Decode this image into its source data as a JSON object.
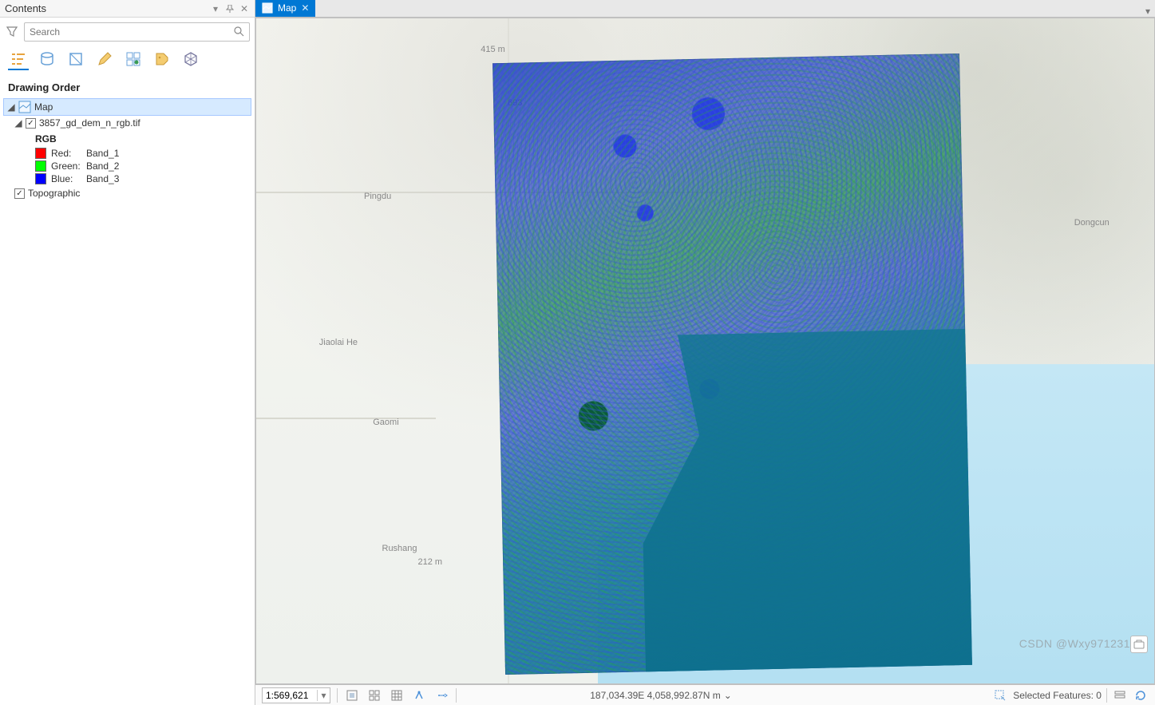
{
  "contents": {
    "title": "Contents",
    "search_placeholder": "Search",
    "section": "Drawing Order",
    "map_node": "Map",
    "layer_node": "3857_gd_dem_n_rgb.tif",
    "rgb_title": "RGB",
    "bands": [
      {
        "color": "#ff0000",
        "label": "Red:",
        "value": "Band_1"
      },
      {
        "color": "#00ff00",
        "label": "Green:",
        "value": "Band_2"
      },
      {
        "color": "#0000ff",
        "label": "Blue:",
        "value": "Band_3"
      }
    ],
    "basemap_node": "Topographic"
  },
  "map_tab": {
    "label": "Map"
  },
  "basemap_labels": {
    "pingdu": "Pingdu",
    "gaomi": "Gaomi",
    "jiaolai": "Jiaolai He",
    "rushang": "Rushang",
    "dongcun": "Dongcun",
    "elev1": "415 m",
    "elev2": "693",
    "elev3": "212 m"
  },
  "statusbar": {
    "scale": "1:569,621",
    "coords": "187,034.39E 4,058,992.87N m",
    "selected": "Selected Features: 0"
  },
  "watermark": "CSDN @Wxy971231"
}
